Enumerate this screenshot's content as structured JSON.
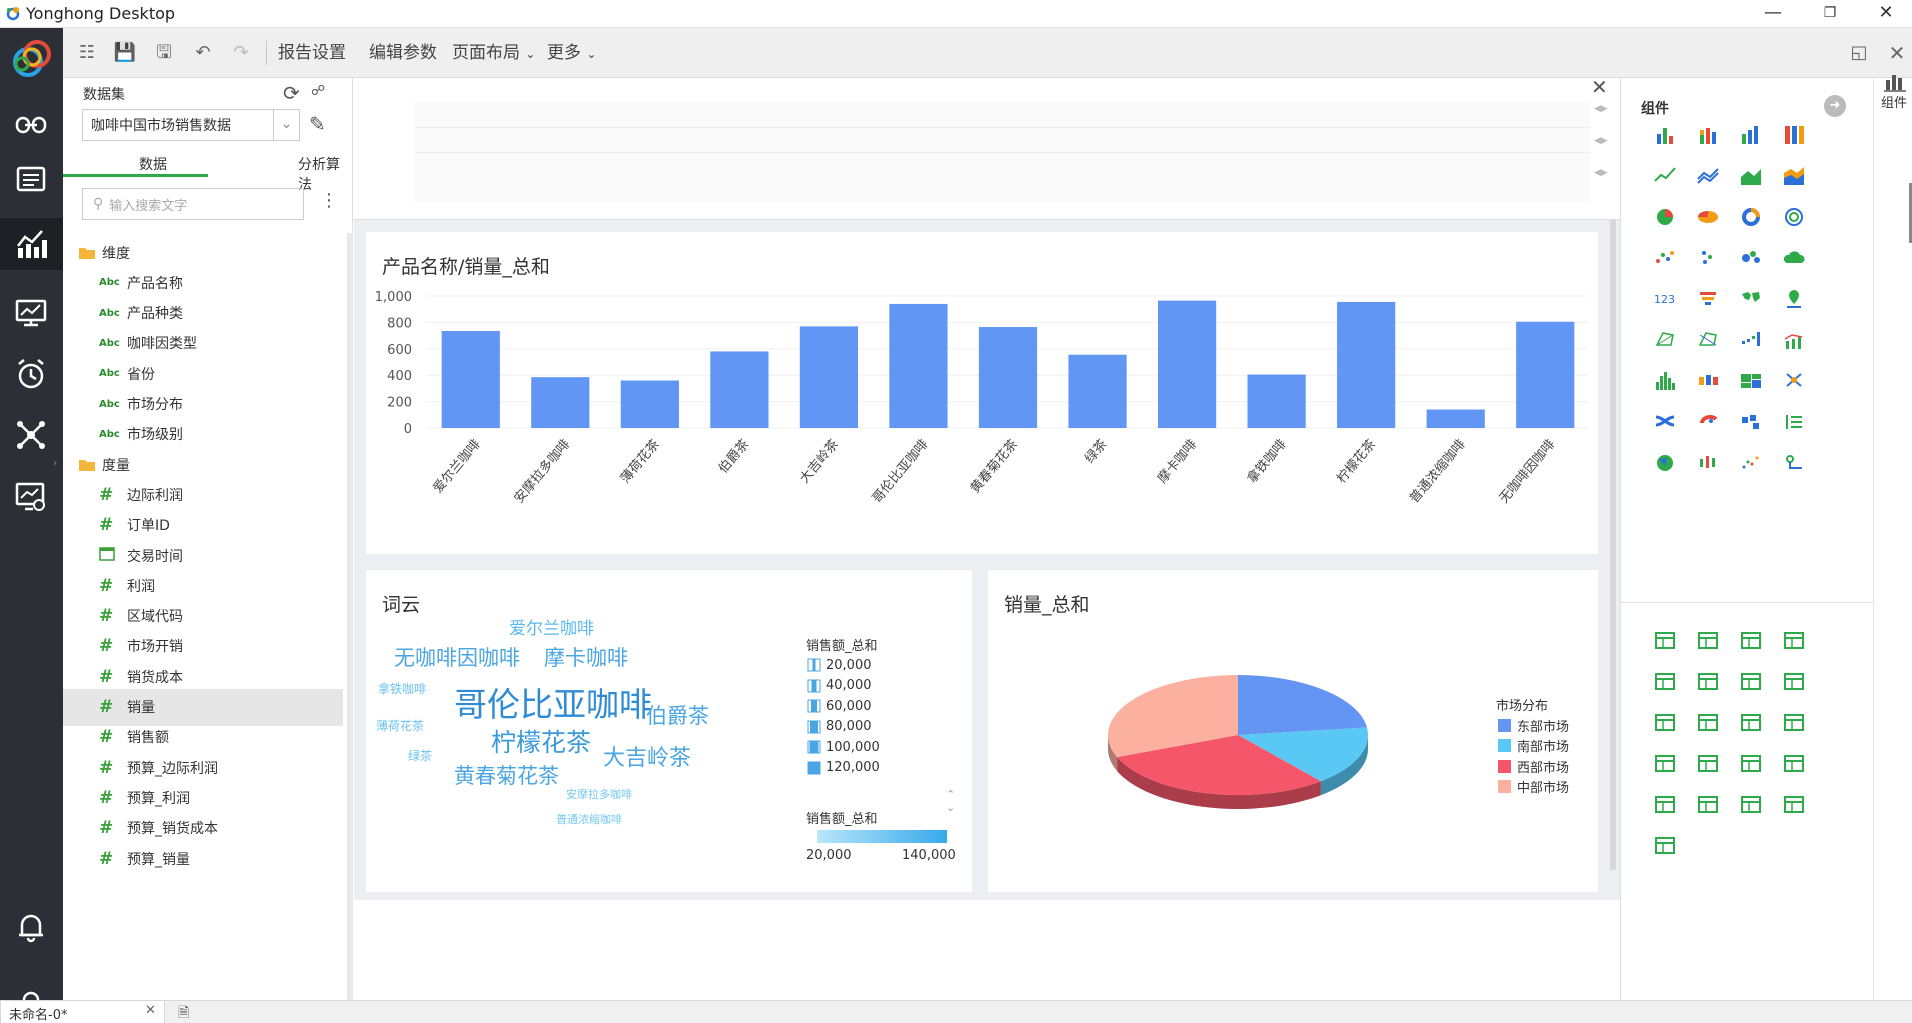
{
  "app": {
    "title": "Yonghong Desktop"
  },
  "toolbar": {
    "report_settings": "报告设置",
    "edit_params": "编辑参数",
    "page_layout": "页面布局",
    "more": "更多"
  },
  "dataset_panel": {
    "label": "数据集",
    "selected_dataset": "咖啡中国市场销售数据",
    "tabs": [
      "数据",
      "分析算法"
    ],
    "search_placeholder": "输入搜索文字",
    "dimension_folder": "维度",
    "dimensions": [
      "产品名称",
      "产品种类",
      "咖啡因类型",
      "省份",
      "市场分布",
      "市场级别"
    ],
    "measure_folder": "度量",
    "measures": [
      "边际利润",
      "订单ID",
      "交易时间",
      "利润",
      "区域代码",
      "市场开销",
      "销货成本",
      "销量",
      "销售额",
      "预算_边际利润",
      "预算_利润",
      "预算_销货成本",
      "预算_销量"
    ],
    "selected_measure": "销量"
  },
  "bar_card": {
    "title": "产品名称/销量_总和"
  },
  "chart_data": [
    {
      "type": "bar",
      "title": "产品名称/销量_总和",
      "categories": [
        "爱尔兰咖啡",
        "安摩拉多咖啡",
        "薄荷花茶",
        "伯爵茶",
        "大吉岭茶",
        "哥伦比亚咖啡",
        "黄春菊花茶",
        "绿茶",
        "摩卡咖啡",
        "拿铁咖啡",
        "柠檬花茶",
        "普通浓缩咖啡",
        "无咖啡因咖啡"
      ],
      "values": [
        735,
        385,
        360,
        580,
        770,
        940,
        765,
        555,
        965,
        405,
        955,
        140,
        805
      ],
      "ylim": [
        0,
        1000
      ],
      "yticks": [
        "1,000",
        "800",
        "600",
        "400",
        "200",
        "0"
      ],
      "color": "#6196f5"
    },
    {
      "type": "pie",
      "title": "销量_总和",
      "legend_title": "市场分布",
      "labels": [
        "东部市场",
        "南部市场",
        "西部市场",
        "中部市场"
      ],
      "values": [
        23,
        16,
        30,
        31
      ],
      "colors": [
        "#6495f3",
        "#5ac8f5",
        "#f5566a",
        "#fbb0a0"
      ]
    }
  ],
  "wordcloud_card": {
    "title": "词云",
    "words": [
      {
        "text": "爱尔兰咖啡",
        "size": 17,
        "color": "#5bb8ec"
      },
      {
        "text": "无咖啡因咖啡",
        "size": 21,
        "color": "#4aa6e3"
      },
      {
        "text": "摩卡咖啡",
        "size": 21,
        "color": "#4aa6e3"
      },
      {
        "text": "拿铁咖啡",
        "size": 12,
        "color": "#6ac3ef"
      },
      {
        "text": "哥伦比亚咖啡",
        "size": 33,
        "color": "#2f8bd6"
      },
      {
        "text": "伯爵茶",
        "size": 21,
        "color": "#4aa6e3"
      },
      {
        "text": "薄荷花茶",
        "size": 12,
        "color": "#6ac3ef"
      },
      {
        "text": "柠檬花茶",
        "size": 25,
        "color": "#3a9ad9"
      },
      {
        "text": "绿茶",
        "size": 12,
        "color": "#6ac3ef"
      },
      {
        "text": "大吉岭茶",
        "size": 22,
        "color": "#4aa6e3"
      },
      {
        "text": "黄春菊花茶",
        "size": 21,
        "color": "#4aa6e3"
      },
      {
        "text": "安摩拉多咖啡",
        "size": 11,
        "color": "#72c8f1"
      },
      {
        "text": "普通浓缩咖啡",
        "size": 11,
        "color": "#72c8f1"
      }
    ],
    "size_legend_title": "销售额_总和",
    "size_legend_items": [
      "20,000",
      "40,000",
      "60,000",
      "80,000",
      "100,000",
      "120,000"
    ],
    "color_legend_title": "销售额_总和",
    "color_legend_min": "20,000",
    "color_legend_max": "140,000"
  },
  "pie_card": {
    "title": "销量_总和",
    "legend_title": "市场分布"
  },
  "component_panel": {
    "title": "组件"
  },
  "right_strip": {
    "label": "组件"
  },
  "statusbar": {
    "tab_label": "未命名-0*"
  },
  "colors": {
    "nav_bg": "#2c3036",
    "accent": "#2faa4a",
    "bar": "#6196f5"
  }
}
